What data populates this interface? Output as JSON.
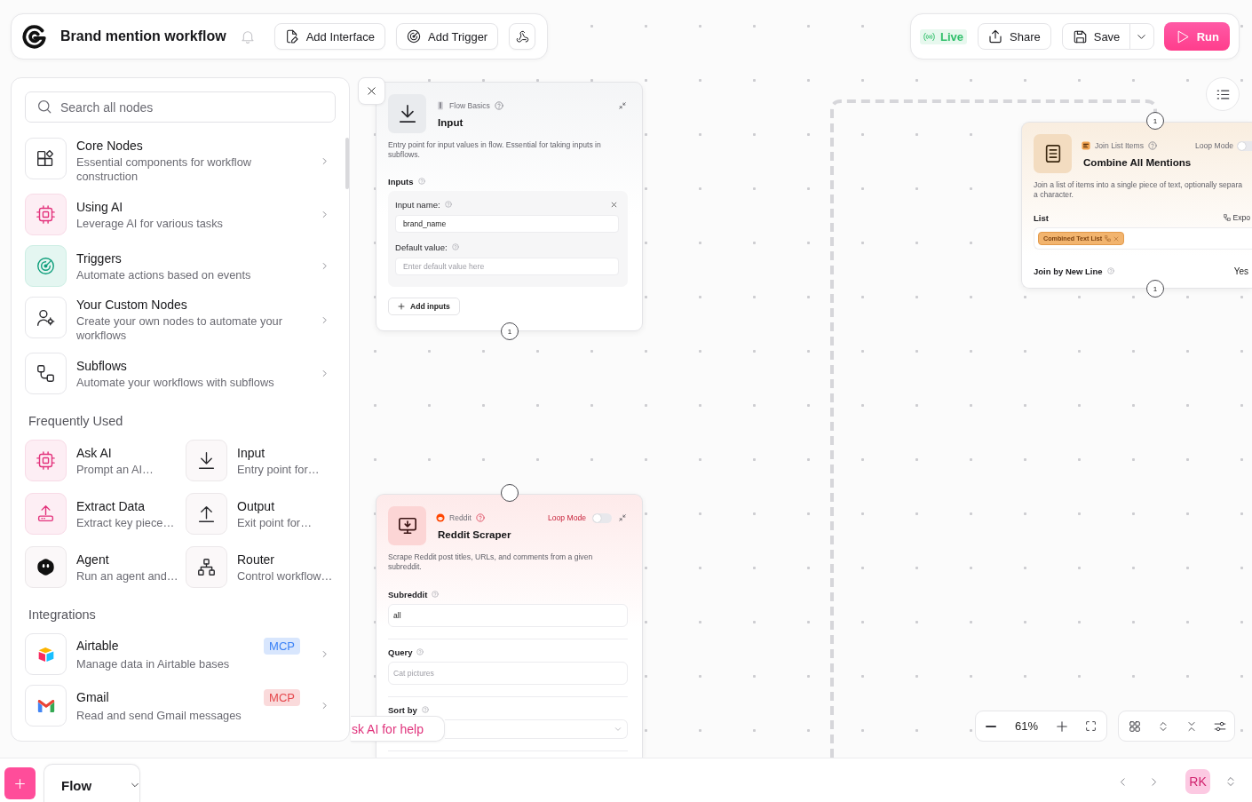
{
  "header": {
    "title": "Brand mention workflow",
    "buttons": [
      {
        "label": "Add Interface"
      },
      {
        "label": "Add Trigger"
      }
    ]
  },
  "actions": {
    "status": "Live",
    "share": "Share",
    "save": "Save",
    "run": "Run"
  },
  "sidebar": {
    "search": {
      "placeholder": "Search all nodes"
    },
    "categories": [
      {
        "title": "Core Nodes",
        "description": "Essential components for workflow construction"
      },
      {
        "title": "Using AI",
        "description": "Leverage AI for various tasks"
      },
      {
        "title": "Triggers",
        "description": "Automate actions based on events"
      },
      {
        "title": "Your Custom Nodes",
        "description": "Create your own nodes to automate your workflows"
      },
      {
        "title": "Subflows",
        "description": "Automate your workflows with subflows"
      }
    ],
    "frequently_used": {
      "title": "Frequently Used",
      "items": [
        {
          "title": "Ask AI",
          "description": "Prompt an AI…"
        },
        {
          "title": "Input",
          "description": "Entry point for…"
        },
        {
          "title": "Extract Data",
          "description": "Extract key piece…"
        },
        {
          "title": "Output",
          "description": "Exit point for…"
        },
        {
          "title": "Agent",
          "description": "Run an agent and…"
        },
        {
          "title": "Router",
          "description": "Control workflow…"
        }
      ]
    },
    "integrations": {
      "title": "Integrations",
      "items": [
        {
          "title": "Airtable",
          "description": "Manage data in Airtable bases",
          "badge": "MCP",
          "color": "#3b82f6"
        },
        {
          "title": "Gmail",
          "description": "Read and send Gmail messages",
          "badge": "MCP",
          "color": "#e5484d"
        }
      ]
    }
  },
  "canvas": {
    "nodes": [
      {
        "kind": "input",
        "category": "Flow Basics",
        "title": "Input",
        "color": "#e9ebee",
        "description": "Entry point for input values in flow. Essential for taking inputs in subflows.",
        "handles": [
          {
            "kind": "bottom",
            "label": "1"
          }
        ],
        "section_label": "Inputs",
        "inputs": [
          {
            "name_label": "Input name:",
            "name_value": "brand_name",
            "default_label": "Default value:",
            "default_placeholder": "Enter default value here"
          }
        ],
        "add_button": "Add inputs"
      },
      {
        "kind": "scraper",
        "category": "Reddit",
        "title": "Reddit Scraper",
        "color": "#fcd5d5",
        "loop_mode": {
          "label": "Loop Mode",
          "on": false
        },
        "description": "Scrape Reddit post titles, URLs, and comments from a given subreddit.",
        "handles": [
          {
            "kind": "top"
          }
        ],
        "fields": [
          {
            "kind": "text",
            "label": "Subreddit",
            "value": "all"
          },
          {
            "kind": "text",
            "label": "Query",
            "placeholder": "Cat pictures"
          },
          {
            "kind": "select",
            "label": "Sort by"
          }
        ]
      },
      {
        "kind": "join",
        "category": "Join List Items",
        "title": "Combine All Mentions",
        "color": "#f3dcc0",
        "loop_mode": {
          "label": "Loop Mode",
          "on": false
        },
        "description_lines": [
          "Join a list of items into a single piece of text, optionally separa",
          "a character."
        ],
        "handles": [
          {
            "kind": "top",
            "label": "1"
          },
          {
            "kind": "bottom",
            "label": "1"
          }
        ],
        "list": {
          "label": "List",
          "action": "Expo",
          "tags": [
            "Combined Text List"
          ]
        },
        "join_new_line": {
          "label": "Join by New Line",
          "value": "Yes"
        }
      }
    ]
  },
  "help_button": {
    "label": "sk AI for help"
  },
  "zoom": {
    "reading": "61%"
  },
  "bottom_bar": {
    "tabs": [
      {
        "label": "Flow",
        "selected": true
      }
    ],
    "avatar": "RK"
  }
}
